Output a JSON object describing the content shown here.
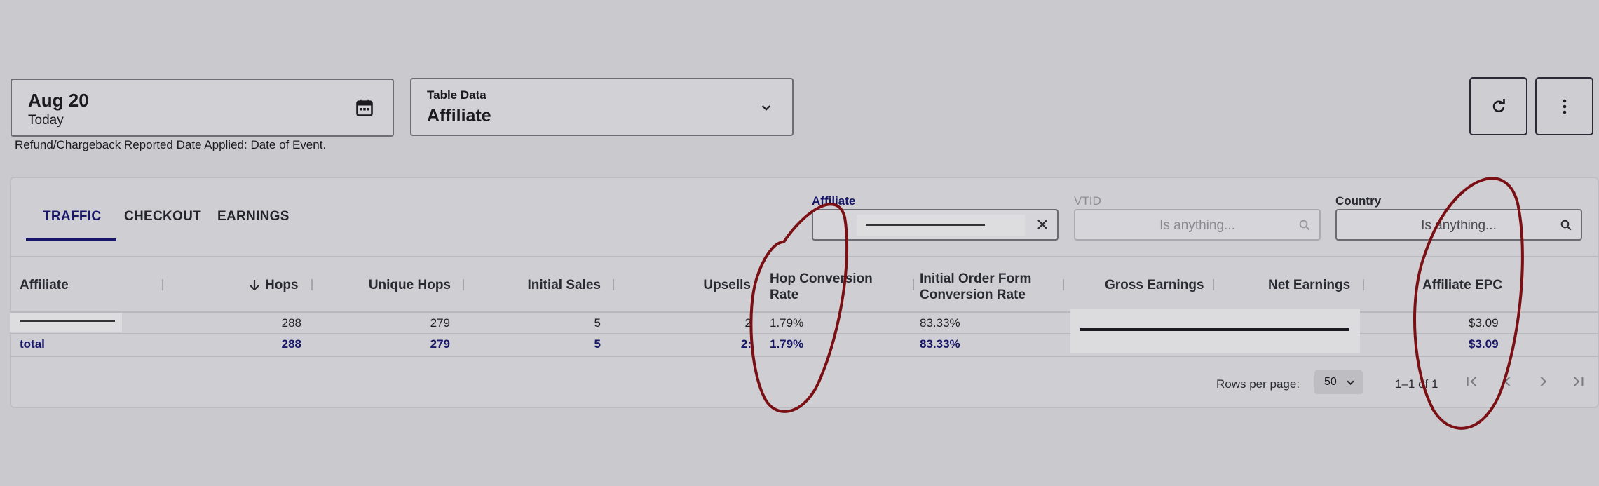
{
  "date_picker": {
    "main": "Aug 20",
    "sub": "Today"
  },
  "table_select": {
    "label": "Table Data",
    "value": "Affiliate"
  },
  "refund_note": "Refund/Chargeback Reported Date Applied: Date of Event.",
  "tabs": [
    {
      "label": "TRAFFIC"
    },
    {
      "label": "CHECKOUT"
    },
    {
      "label": "EARNINGS"
    }
  ],
  "filters": {
    "affiliate": {
      "label": "Affiliate",
      "value": ""
    },
    "vtid": {
      "label": "VTID",
      "placeholder": "Is anything..."
    },
    "country": {
      "label": "Country",
      "placeholder": "Is anything..."
    }
  },
  "columns": {
    "affiliate": "Affiliate",
    "hops": "Hops",
    "unique_hops": "Unique Hops",
    "initial_sales": "Initial Sales",
    "upsells": "Upsells",
    "hop_conversion_rate_1": "Hop Conversion",
    "hop_conversion_rate_2": "Rate",
    "initial_order_1": "Initial Order Form",
    "initial_order_2": "Conversion Rate",
    "gross_earnings": "Gross Earnings",
    "net_earnings": "Net Earnings",
    "affiliate_epc": "Affiliate EPC"
  },
  "rows": [
    {
      "affiliate": "",
      "hops": "288",
      "unique_hops": "279",
      "initial_sales": "5",
      "upsells": "2",
      "hop_conversion_rate": "1.79%",
      "initial_order_conversion": "83.33%",
      "affiliate_epc": "$3.09"
    }
  ],
  "total_row": {
    "label": "total",
    "hops": "288",
    "unique_hops": "279",
    "initial_sales": "5",
    "upsells": "2:",
    "hop_conversion_rate": "1.79%",
    "initial_order_conversion": "83.33%",
    "affiliate_epc": "$3.09"
  },
  "pagination": {
    "rows_per_page_label": "Rows per page:",
    "rows_per_page_value": "50",
    "range": "1–1 of 1"
  },
  "colors": {
    "accent": "#171668",
    "annotation": "#7a0f14",
    "background": "#c9c9ce"
  },
  "icons": [
    "calendar-icon",
    "chevron-down-icon",
    "refresh-icon",
    "more-vert-icon",
    "close-icon",
    "search-icon",
    "sort-down-icon",
    "first-page-icon",
    "prev-page-icon",
    "next-page-icon",
    "last-page-icon"
  ]
}
